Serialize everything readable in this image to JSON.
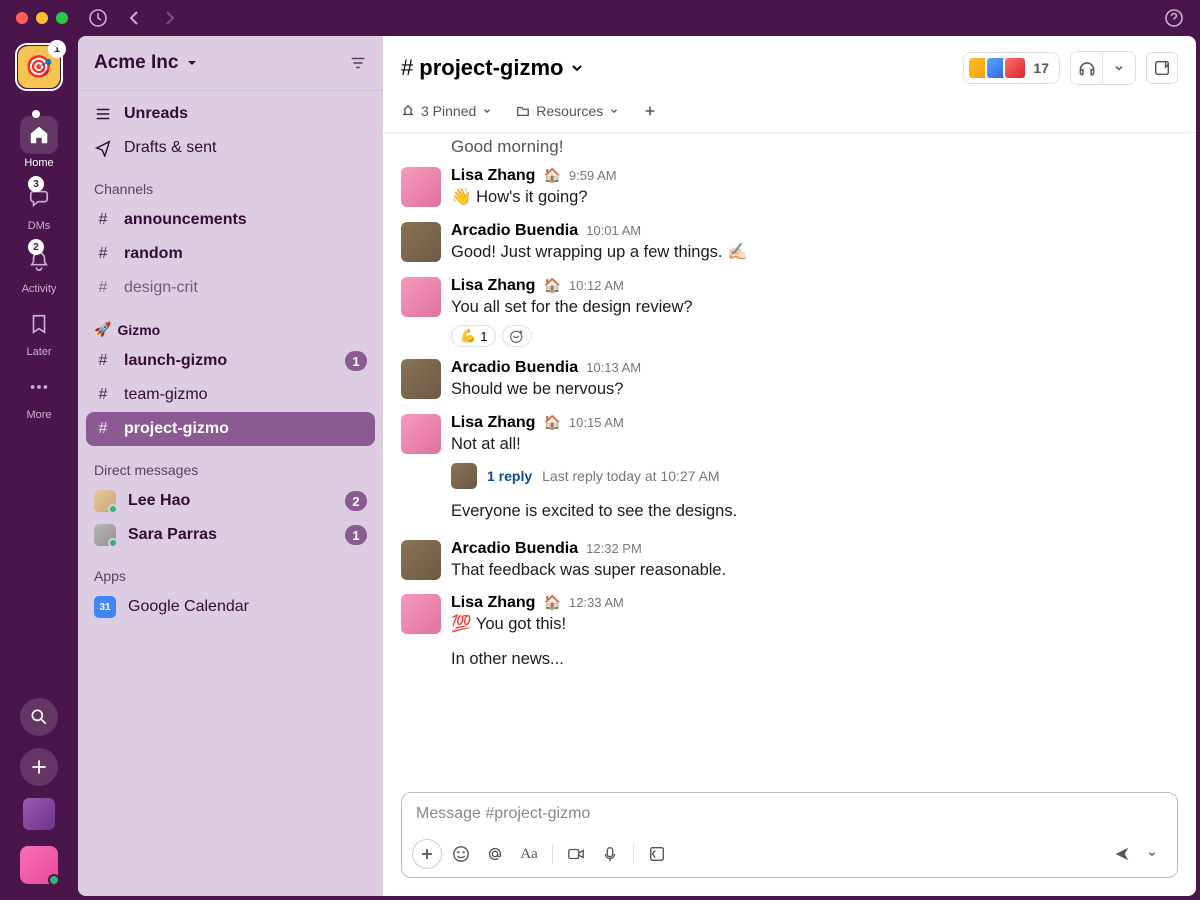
{
  "workspace": {
    "name": "Acme Inc",
    "badge": "1"
  },
  "rail": {
    "home": "Home",
    "dms": "DMs",
    "activity": "Activity",
    "later": "Later",
    "more": "More",
    "dms_badge": "3",
    "activity_badge": "2"
  },
  "sidebar": {
    "unreads": "Unreads",
    "drafts": "Drafts & sent",
    "channels_header": "Channels",
    "channels": [
      {
        "name": "announcements",
        "bold": true
      },
      {
        "name": "random",
        "bold": true
      },
      {
        "name": "design-crit",
        "bold": false
      }
    ],
    "gizmo_header": "Gizmo",
    "gizmo": [
      {
        "name": "launch-gizmo",
        "bold": true,
        "badge": "1"
      },
      {
        "name": "team-gizmo",
        "bold": false
      },
      {
        "name": "project-gizmo",
        "bold": true,
        "selected": true
      }
    ],
    "dms_header": "Direct messages",
    "dms": [
      {
        "name": "Lee Hao",
        "badge": "2",
        "avatar": "av-lee"
      },
      {
        "name": "Sara Parras",
        "badge": "1",
        "avatar": "av-sara"
      }
    ],
    "apps_header": "Apps",
    "apps": [
      {
        "name": "Google Calendar",
        "icon": "31"
      }
    ]
  },
  "chat": {
    "title": "project-gizmo",
    "members_count": "17",
    "pinned_label": "3 Pinned",
    "resources_label": "Resources",
    "cut_message": "Good morning!",
    "composer_placeholder": "Message #project-gizmo"
  },
  "messages": [
    {
      "author": "Lisa Zhang",
      "status": "🏠",
      "time": "9:59 AM",
      "text": "👋 How's it going?",
      "avatar": "av-lisa"
    },
    {
      "author": "Arcadio Buendia",
      "status": "",
      "time": "10:01 AM",
      "text": "Good! Just wrapping up a few things. ✍🏻",
      "avatar": "av-arc"
    },
    {
      "author": "Lisa Zhang",
      "status": "🏠",
      "time": "10:12 AM",
      "text": "You all set for the design review?",
      "avatar": "av-lisa",
      "reactions": [
        {
          "emoji": "💪",
          "count": "1"
        }
      ]
    },
    {
      "author": "Arcadio Buendia",
      "status": "",
      "time": "10:13 AM",
      "text": "Should we be nervous?",
      "avatar": "av-arc"
    },
    {
      "author": "Lisa Zhang",
      "status": "🏠",
      "time": "10:15 AM",
      "text": "Not at all!",
      "avatar": "av-lisa",
      "thread": {
        "count": "1 reply",
        "time": "Last reply today at 10:27 AM",
        "avatar": "av-arc"
      },
      "continuation": "Everyone is excited to see the designs."
    },
    {
      "author": "Arcadio Buendia",
      "status": "",
      "time": "12:32 PM",
      "text": "That feedback was super reasonable.",
      "avatar": "av-arc"
    },
    {
      "author": "Lisa Zhang",
      "status": "🏠",
      "time": "12:33 AM",
      "text": "💯 You got this!",
      "avatar": "av-lisa",
      "continuation": "In other news..."
    }
  ]
}
